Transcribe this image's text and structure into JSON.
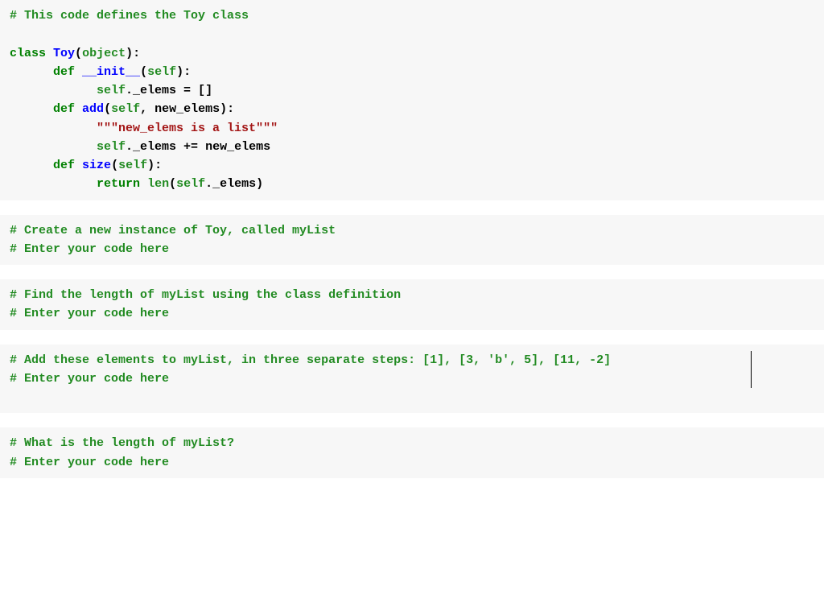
{
  "cell1": {
    "l1_comment": "# This code defines the Toy class",
    "l3_kw_class": "class",
    "l3_classname": "Toy",
    "l3_paren_open": "(",
    "l3_object": "object",
    "l3_paren_close_colon": "):",
    "l4_indent": "      ",
    "l4_def": "def",
    "l4_name": "__init__",
    "l4_open": "(",
    "l4_self": "self",
    "l4_close": "):",
    "l5_indent": "            ",
    "l5_self": "self",
    "l5_attr": "._elems = []",
    "l6_indent": "      ",
    "l6_def": "def",
    "l6_name": "add",
    "l6_open": "(",
    "l6_self": "self",
    "l6_comma": ", ",
    "l6_arg": "new_elems",
    "l6_close": "):",
    "l7_indent": "            ",
    "l7_docstr": "\"\"\"new_elems is a list\"\"\"",
    "l8_indent": "            ",
    "l8_self": "self",
    "l8_expr": "._elems += new_elems",
    "l9_indent": "      ",
    "l9_def": "def",
    "l9_name": "size",
    "l9_open": "(",
    "l9_self": "self",
    "l9_close": "):",
    "l10_indent": "            ",
    "l10_return": "return",
    "l10_sp": " ",
    "l10_len": "len",
    "l10_open": "(",
    "l10_self": "self",
    "l10_attr": "._elems)"
  },
  "cell2": {
    "l1": "# Create a new instance of Toy, called myList",
    "l2": "# Enter your code here"
  },
  "cell3": {
    "l1": "# Find the length of myList using the class definition",
    "l2": "# Enter your code here"
  },
  "cell4": {
    "l1": "# Add these elements to myList, in three separate steps: [1], [3, 'b', 5], [11, -2]",
    "l2": "# Enter your code here"
  },
  "cell5": {
    "l1": "# What is the length of myList?",
    "l2": "# Enter your code here"
  }
}
